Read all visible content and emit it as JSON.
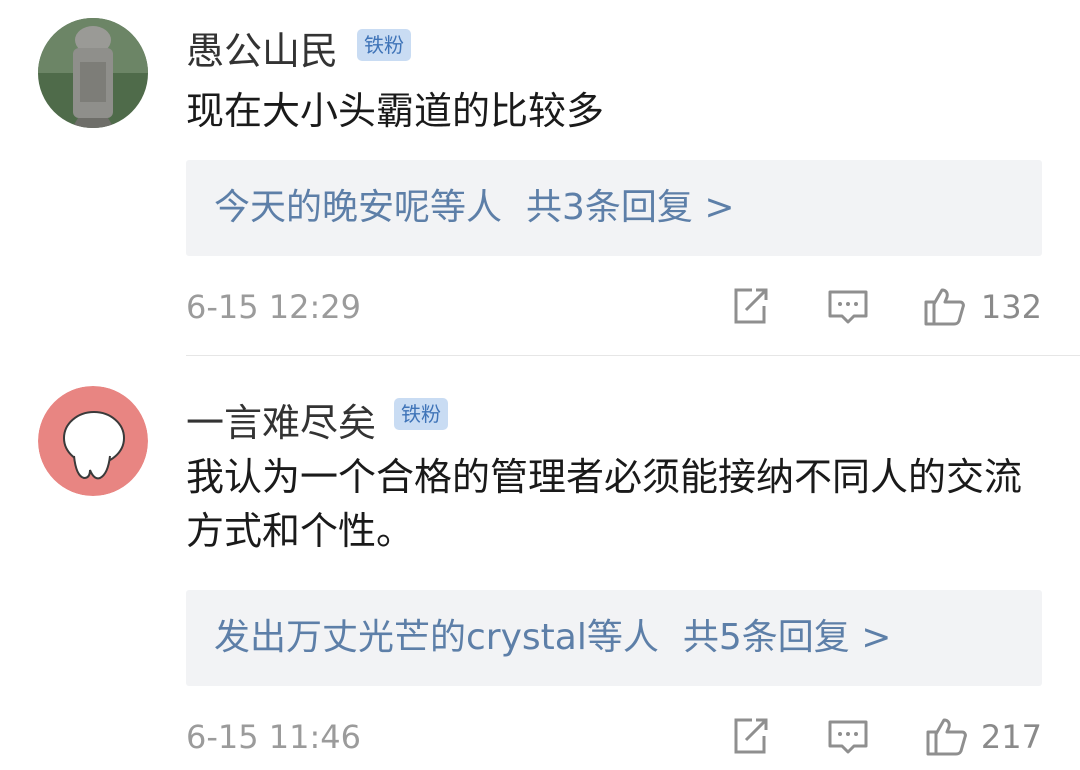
{
  "comments": [
    {
      "username": "愚公山民",
      "badge": "铁粉",
      "text": "现在大小头霸道的比较多",
      "replies_names": "今天的晚安呢等人",
      "replies_total": "共3条回复 >",
      "time": "6-15 12:29",
      "likes": "132",
      "avatar_icon": "stone-statue-avatar"
    },
    {
      "username": "一言难尽矣",
      "badge": "铁粉",
      "text": "我认为一个合格的管理者必须能接纳不同人的交流方式和个性。",
      "replies_names": "发出万丈光芒的crystal等人",
      "replies_total": "共5条回复 >",
      "time": "6-15 11:46",
      "likes": "217",
      "avatar_icon": "cartoon-face-avatar"
    }
  ],
  "icons": {
    "share": "share-icon",
    "comment": "comment-icon",
    "like": "thumbs-up-icon"
  },
  "colors": {
    "badge_bg": "#c9dcf3",
    "badge_text": "#3f74b8",
    "reply_text": "#5d7fa8",
    "reply_bg": "#f2f3f5",
    "avatar2_bg": "#e88582"
  }
}
